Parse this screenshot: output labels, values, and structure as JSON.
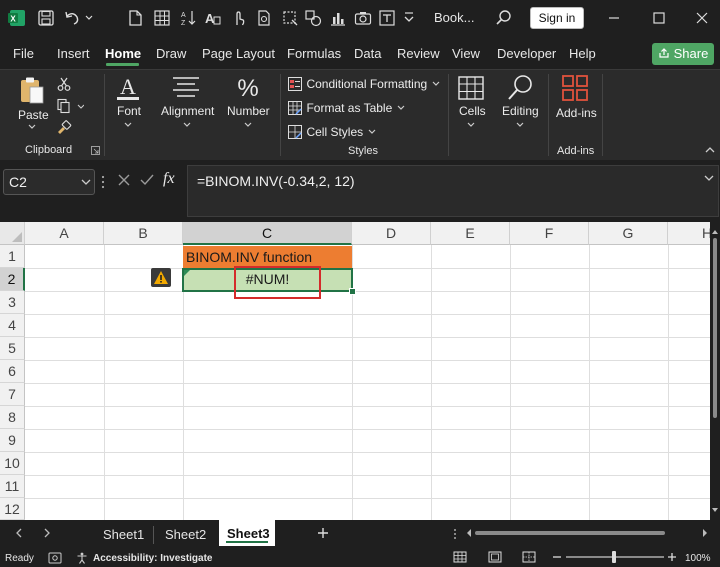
{
  "titlebar": {
    "doc_title": "Book...",
    "signin_label": "Sign in"
  },
  "menu": {
    "tabs": [
      "File",
      "Insert",
      "Home",
      "Draw",
      "Page Layout",
      "Formulas",
      "Data",
      "Review",
      "View",
      "Developer",
      "Help"
    ],
    "share_label": "Share"
  },
  "ribbon": {
    "paste_label": "Paste",
    "clipboard_label": "Clipboard",
    "font_label": "Font",
    "alignment_label": "Alignment",
    "number_label": "Number",
    "conditional_formatting": "Conditional Formatting",
    "format_as_table": "Format as Table",
    "cell_styles": "Cell Styles",
    "styles_label": "Styles",
    "cells_label": "Cells",
    "editing_label": "Editing",
    "addins_label": "Add-ins",
    "addins_group_label": "Add-ins"
  },
  "formula_bar": {
    "name_box": "C2",
    "fx_label": "fx",
    "formula": "=BINOM.INV(-0.34,2, 12)"
  },
  "grid": {
    "columns": [
      "A",
      "B",
      "C",
      "D",
      "E",
      "F",
      "G",
      "H"
    ],
    "rows": [
      "1",
      "2",
      "3",
      "4",
      "5",
      "6",
      "7",
      "8",
      "9",
      "10",
      "11",
      "12"
    ],
    "c1": "BINOM.INV function",
    "c2": "#NUM!"
  },
  "sheets": {
    "tabs": [
      "Sheet1",
      "Sheet2",
      "Sheet3"
    ],
    "active": "Sheet3"
  },
  "status": {
    "ready": "Ready",
    "accessibility": "Accessibility: Investigate",
    "zoom": "100%"
  },
  "colors": {
    "accent": "#4fa664",
    "header_fill": "#ed7d31",
    "result_fill": "#c6e0b4",
    "highlight_border": "#d42b2b",
    "warning": "#f2a900"
  }
}
